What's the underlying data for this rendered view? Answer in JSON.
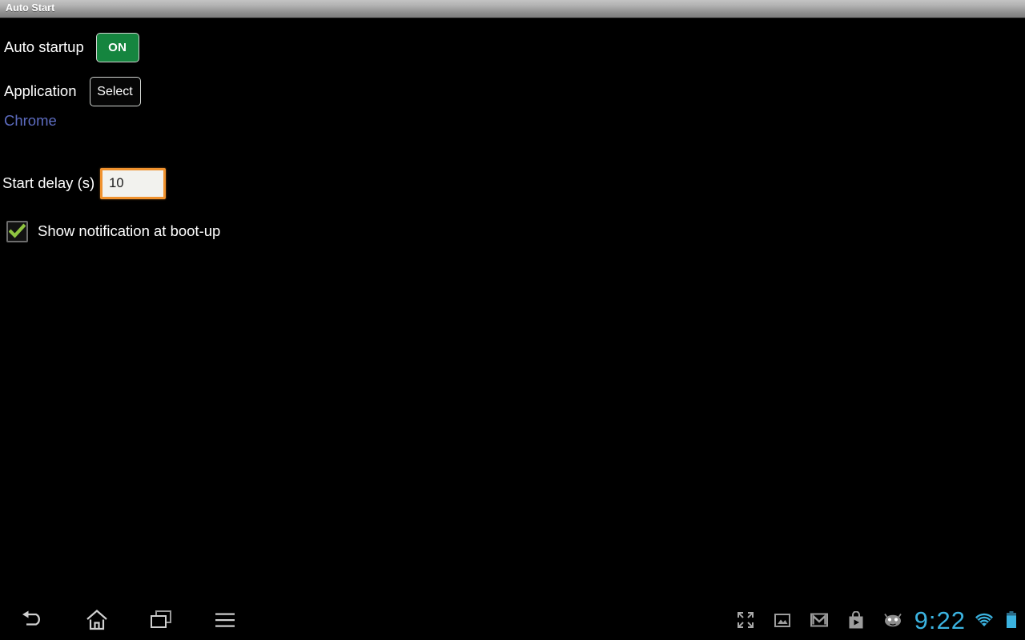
{
  "window": {
    "title": "Auto Start"
  },
  "settings": {
    "auto_startup": {
      "label": "Auto startup",
      "toggle_label": "ON",
      "toggle_state": "on",
      "toggle_color": "#15853f"
    },
    "application": {
      "label": "Application",
      "select_button_label": "Select",
      "selected_app": "Chrome",
      "selected_app_color": "#5d6cc0"
    },
    "start_delay": {
      "label": "Start delay (s)",
      "value": "10",
      "focus_border_color": "#f0922e"
    },
    "show_notification": {
      "label": "Show notification at boot-up",
      "checked": true,
      "check_color": "#8fc440"
    }
  },
  "navbar": {
    "back": "back-button",
    "home": "home-button",
    "recents": "recent-apps-button",
    "menu": "menu-button"
  },
  "statusbar": {
    "icons": [
      "fullscreen-icon",
      "gallery-icon",
      "gmail-icon",
      "play-store-icon",
      "android-icon"
    ],
    "clock": "9:22",
    "clock_color": "#3bb3e0",
    "wifi": "wifi-icon",
    "battery": "battery-icon"
  }
}
